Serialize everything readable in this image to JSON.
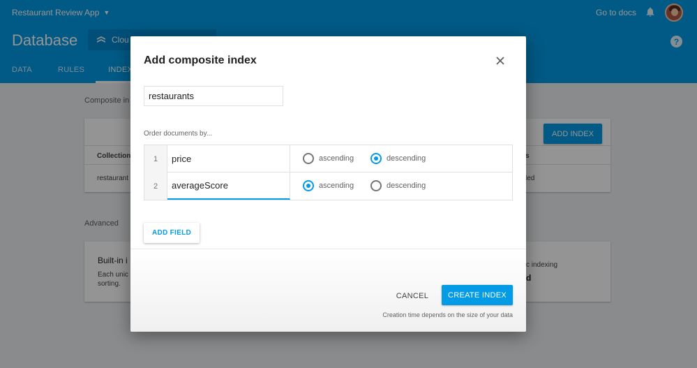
{
  "colors": {
    "primary": "#039be5",
    "primary_dark": "#0288d1"
  },
  "header": {
    "app_name": "Restaurant Review App",
    "docs_link": "Go to docs",
    "page_title": "Database",
    "db_selector": "Clou",
    "tabs": [
      {
        "label": "DATA"
      },
      {
        "label": "RULES"
      },
      {
        "label": "INDEX"
      }
    ],
    "icons": {
      "bell": "bell-icon",
      "help": "help-icon",
      "avatar": "user-avatar"
    }
  },
  "background": {
    "composite_label": "Composite in",
    "add_index_label": "ADD INDEX",
    "collection_col": "Collection",
    "collection_cell": "restaurant",
    "status_col": "s",
    "status_cell": "led",
    "advanced_label": "Advanced",
    "builtin_title": "Built-in i",
    "builtin_desc_1": "Each unic",
    "builtin_desc_2": "sorting.",
    "auto_indexing": "c indexing",
    "auto_bold": "d"
  },
  "dialog": {
    "title": "Add composite index",
    "collection_value": "restaurants",
    "order_label": "Order documents by...",
    "fields": [
      {
        "num": "1",
        "name": "price",
        "asc_label": "ascending",
        "desc_label": "descending",
        "selected": "descending"
      },
      {
        "num": "2",
        "name": "averageScore",
        "asc_label": "ascending",
        "desc_label": "descending",
        "selected": "ascending"
      }
    ],
    "add_field_label": "ADD FIELD",
    "cancel_label": "CANCEL",
    "create_label": "CREATE INDEX",
    "footer_note": "Creation time depends on the size of your data"
  }
}
